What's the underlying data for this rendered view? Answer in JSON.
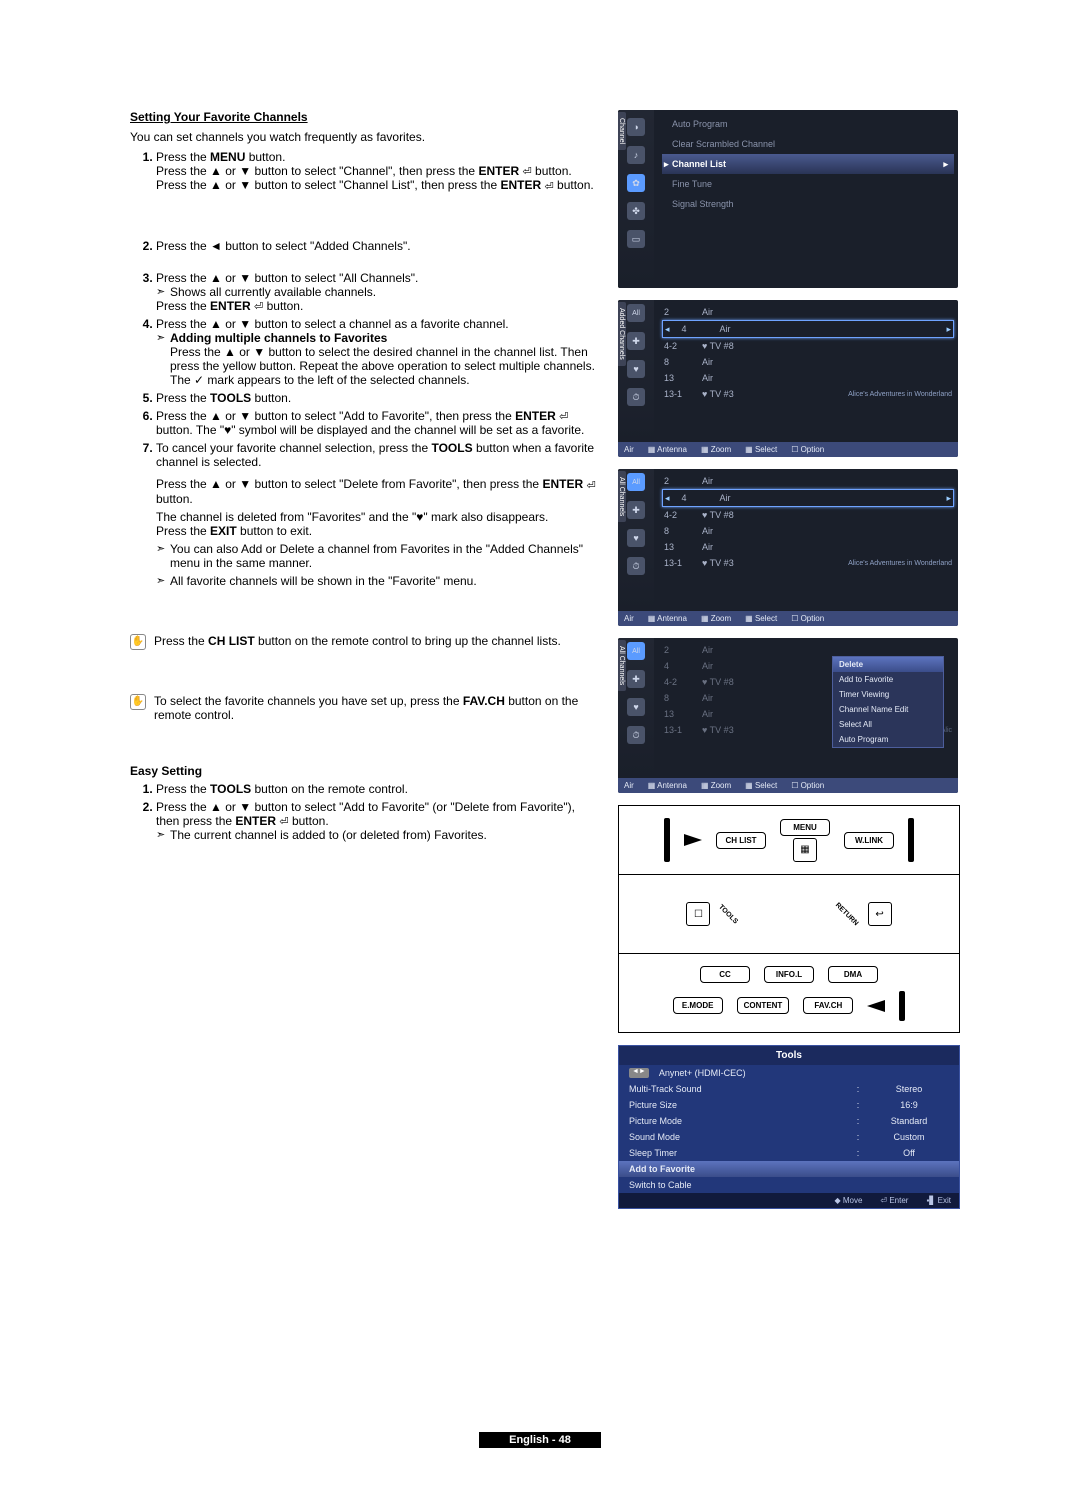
{
  "section": {
    "title": "Setting Your Favorite Channels",
    "intro": "You can set channels you watch frequently as favorites."
  },
  "steps": {
    "s1_a": "Press the ",
    "s1_menu": "MENU",
    "s1_b": " button.",
    "s1_c": "Press the ▲ or ▼ button to select \"Channel\", then press the ",
    "s1_enter": "ENTER",
    "s1_d": " button.",
    "s1_e": "Press the ▲ or ▼ button to select \"Channel List\", then press the ",
    "s1_f": " button.",
    "s2": "Press the ◄ button to select \"Added Channels\".",
    "s3_a": "Press the ▲ or ▼ button to select \"All Channels\".",
    "s3_sub": "Shows all currently available channels.",
    "s3_b": "Press the ",
    "s3_c": " button.",
    "s4_a": "Press the ▲ or ▼ button to select a channel as a favorite channel.",
    "s4_sub_title": "Adding multiple channels to Favorites",
    "s4_sub_body": "Press the ▲ or ▼ button to select the desired channel in the channel list. Then press the yellow button. Repeat the above operation to select multiple channels. The ✓ mark appears to the left of the selected channels.",
    "s5_a": "Press the ",
    "s5_tools": "TOOLS",
    "s5_b": " button.",
    "s6_a": "Press the ▲ or ▼ button to select \"Add to Favorite\", then press the ",
    "s6_b": " button. The \"♥\" symbol will be displayed and the channel will be set as a favorite.",
    "s7_a": "To cancel your favorite channel selection, press the ",
    "s7_b": " button when a favorite channel is selected.",
    "s7_c": "Press the ▲ or ▼ button to select \"Delete from Favorite\", then press the ",
    "s7_d": " button.",
    "s7_e": "The channel is deleted from \"Favorites\" and the \"♥\" mark also disappears.",
    "s7_f": "Press the ",
    "s7_exit": "EXIT",
    "s7_g": " button to exit.",
    "post_sub1": "You can also Add or Delete a channel from Favorites in the \"Added Channels\" menu in the same manner.",
    "post_sub2": "All favorite channels will be shown in the \"Favorite\" menu."
  },
  "notes": {
    "n1_a": "Press the ",
    "n1_btn": "CH LIST",
    "n1_b": " button on the remote control to bring up the channel lists.",
    "n2_a": "To select the favorite channels you have set up, press the ",
    "n2_btn": "FAV.CH",
    "n2_b": " button on the remote control."
  },
  "easy": {
    "title": "Easy Setting",
    "e1_a": "Press the ",
    "e1_b": " button on the remote control.",
    "e2_a": "Press the ▲ or ▼ button to select \"Add to Favorite\" (or \"Delete from Favorite\"), then press the ",
    "e2_b": " button.",
    "e2_sub": "The current channel is added to (or deleted from) Favorites."
  },
  "page_footer": "English - 48",
  "osd_menu": {
    "items": [
      "Auto Program",
      "Clear Scrambled Channel",
      "Channel List",
      "Fine Tune",
      "Signal Strength"
    ],
    "side_label": "Channel"
  },
  "ch_panel_side_labels": {
    "added": "Added Channels",
    "all": "All Channels"
  },
  "ch_rows": [
    {
      "num": "2",
      "label": "Air",
      "extra": ""
    },
    {
      "num": "4",
      "label": "Air",
      "extra": ""
    },
    {
      "num": "4-2",
      "label": "♥ TV #8",
      "extra": ""
    },
    {
      "num": "8",
      "label": "Air",
      "extra": ""
    },
    {
      "num": "13",
      "label": "Air",
      "extra": ""
    },
    {
      "num": "13-1",
      "label": "♥ TV #3",
      "extra": "Alice's Adventures in Wonderland"
    }
  ],
  "panel_footer": {
    "a": "Air",
    "b": "▦ Antenna",
    "c": "▦ Zoom",
    "d": "▦ Select",
    "e": "☐ Option"
  },
  "ctx_menu": [
    "Delete",
    "Add to Favorite",
    "Timer Viewing",
    "Channel Name Edit",
    "Select All",
    "Auto Program"
  ],
  "remote_btns": {
    "chlist": "CH LIST",
    "menu": "MENU",
    "wlink": "W.LINK",
    "cc": "CC",
    "infol": "INFO.L",
    "dma": "DMA",
    "emode": "E.MODE",
    "content": "CONTENT",
    "favch": "FAV.CH",
    "tools": "TOOLS",
    "return": "RETURN"
  },
  "tools_panel": {
    "title": "Tools",
    "anynet": "Anynet+ (HDMI-CEC)",
    "rows": [
      {
        "label": "Multi-Track Sound",
        "value": "Stereo"
      },
      {
        "label": "Picture Size",
        "value": "16:9"
      },
      {
        "label": "Picture Mode",
        "value": "Standard"
      },
      {
        "label": "Sound Mode",
        "value": "Custom"
      },
      {
        "label": "Sleep Timer",
        "value": "Off"
      }
    ],
    "addfav": "Add to Favorite",
    "switch": "Switch to Cable",
    "foot_move": "◆ Move",
    "foot_enter": "⏎ Enter",
    "foot_exit": "▪▋ Exit"
  }
}
